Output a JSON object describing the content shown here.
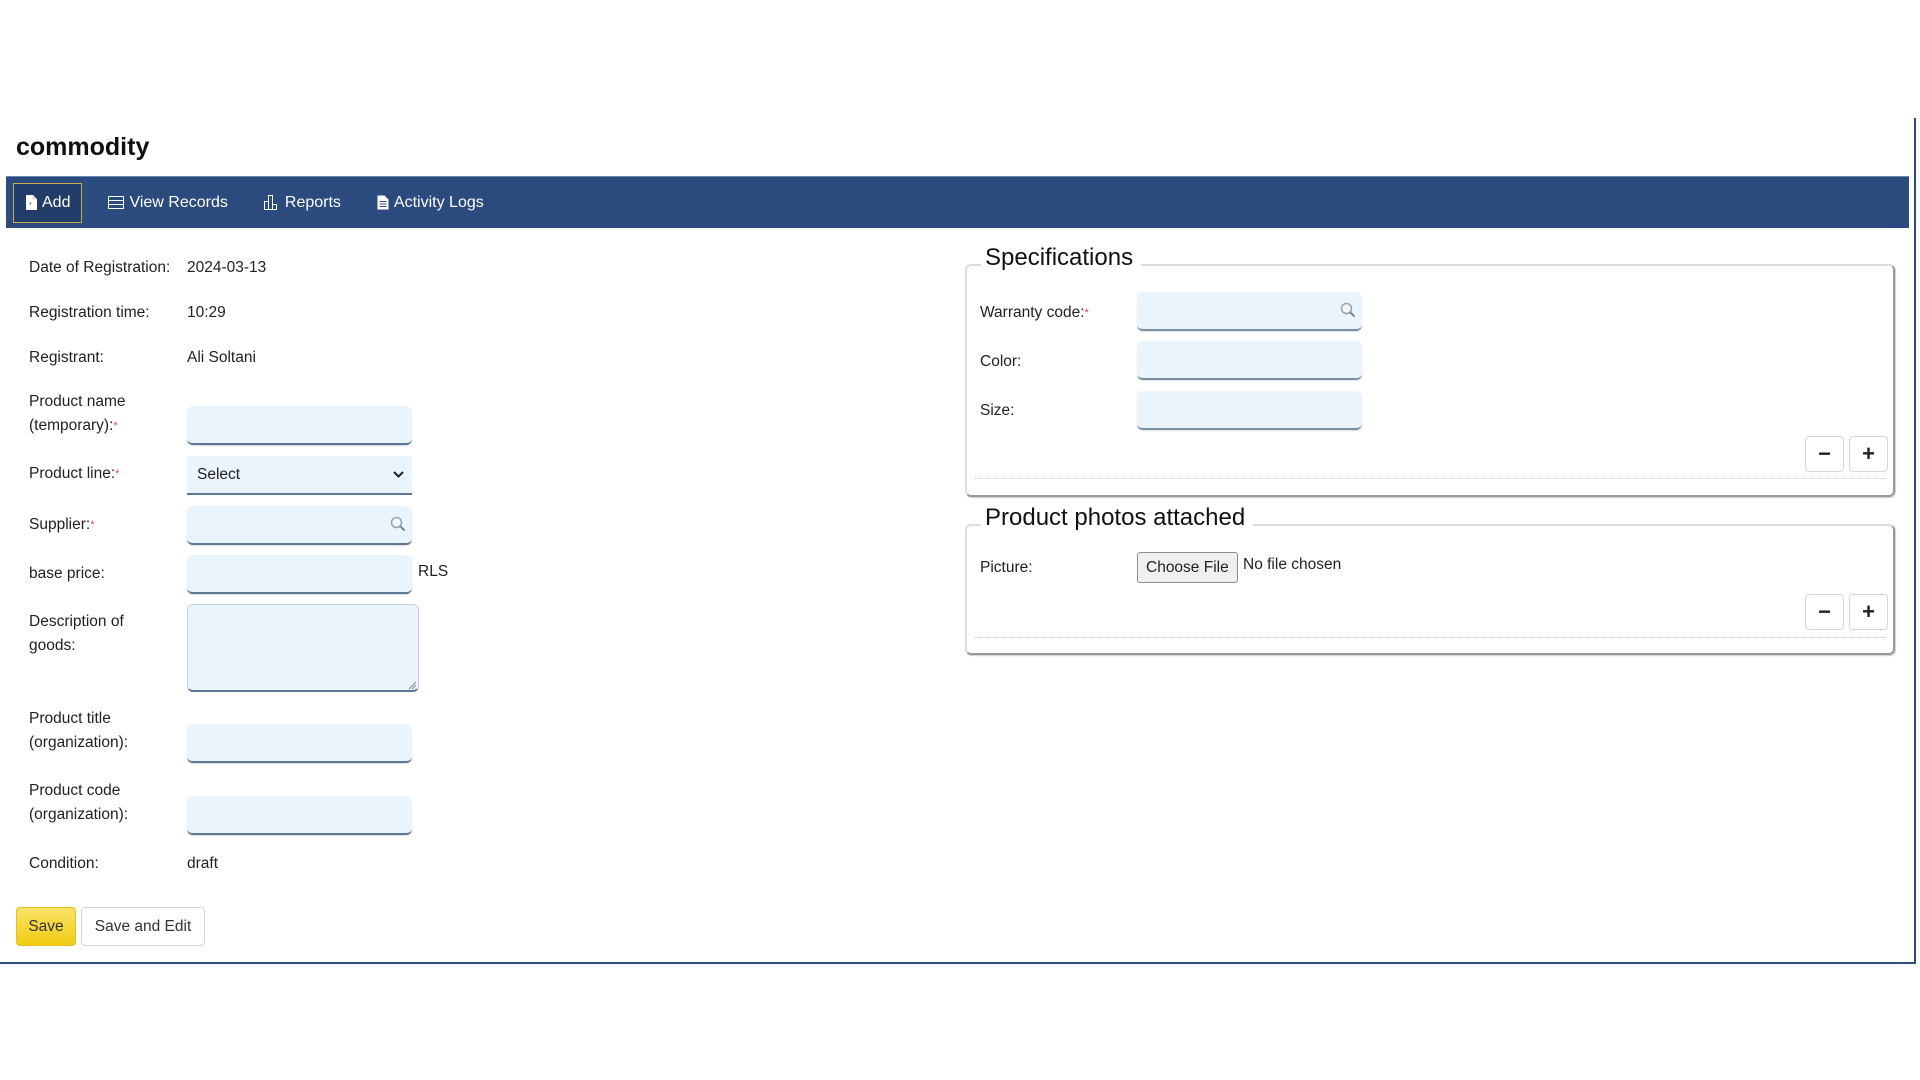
{
  "page": {
    "title": "commodity"
  },
  "nav": {
    "items": [
      {
        "label": "Add",
        "icon": "file-add-icon",
        "active": true
      },
      {
        "label": "View Records",
        "icon": "table-icon",
        "active": false
      },
      {
        "label": "Reports",
        "icon": "bar-chart-icon",
        "active": false
      },
      {
        "label": "Activity Logs",
        "icon": "document-icon",
        "active": false
      }
    ]
  },
  "form": {
    "date": {
      "label": "Date of Registration:",
      "value": "2024-03-13"
    },
    "time": {
      "label": "Registration time:",
      "value": "10:29"
    },
    "registrant": {
      "label": "Registrant:",
      "value": "Ali Soltani"
    },
    "product_name": {
      "label_line1": "Product name",
      "label_line2": "(temporary):",
      "required": "*",
      "value": ""
    },
    "product_line": {
      "label": "Product line:",
      "required": "*",
      "selected": "Select"
    },
    "supplier": {
      "label": "Supplier:",
      "required": "*",
      "value": ""
    },
    "base_price": {
      "label": "base price:",
      "value": "",
      "suffix": "RLS"
    },
    "description": {
      "label_line1": "Description of",
      "label_line2": "goods:",
      "value": ""
    },
    "product_title": {
      "label_line1": "Product title",
      "label_line2": "(organization):",
      "value": ""
    },
    "product_code": {
      "label_line1": "Product code",
      "label_line2": "(organization):",
      "value": ""
    },
    "condition": {
      "label": "Condition:",
      "value": "draft"
    },
    "buttons": {
      "save": "Save",
      "save_and_edit": "Save and Edit"
    }
  },
  "specifications": {
    "legend": "Specifications",
    "warranty_code": {
      "label": "Warranty code:",
      "required": "*",
      "value": ""
    },
    "color": {
      "label": "Color:",
      "value": ""
    },
    "size": {
      "label": "Size:",
      "value": ""
    },
    "remove_label": "−",
    "add_label": "+"
  },
  "photos": {
    "legend": "Product photos attached",
    "picture": {
      "label": "Picture:",
      "button": "Choose File",
      "status": "No file chosen"
    },
    "remove_label": "−",
    "add_label": "+"
  },
  "colors": {
    "nav_bg": "#2b4a7e",
    "save_btn": "#f1cc12",
    "input_bg": "#eaf4fd",
    "required": "#e0474c"
  }
}
